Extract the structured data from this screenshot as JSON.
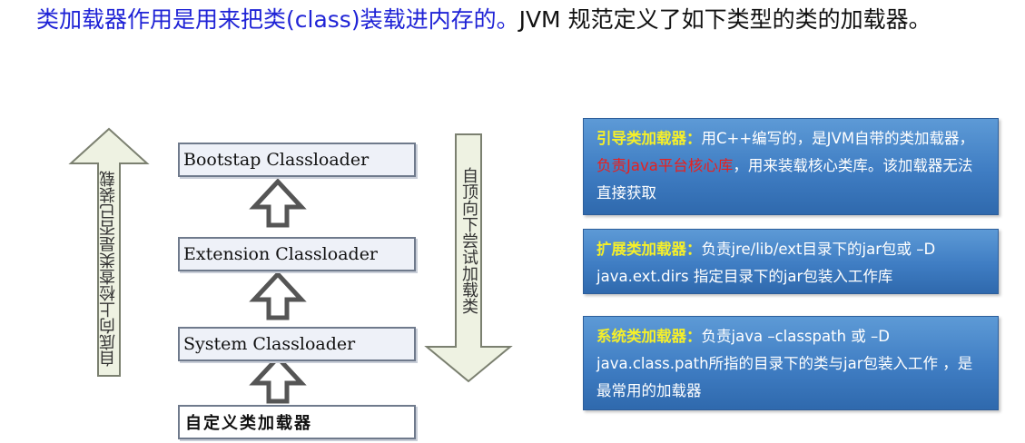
{
  "heading": {
    "highlight": "类加载器作用是用来把类(class)装载进内存的。",
    "rest": "JVM 规范定义了如下类型的类的加载器。"
  },
  "diagram": {
    "loaders": [
      "Bootstap Classloader",
      "Extension Classloader",
      "System Classloader",
      "自定义类加载器"
    ],
    "left_arrow_label": "自底向上检查类是否已装载",
    "right_arrow_label": "自顶向下尝试加载类"
  },
  "info": [
    {
      "title": "引导类加载器",
      "sep": "：",
      "text_a": "用C++编写的，是JVM自带的类加载器，",
      "text_red": "负责Java平台核心库",
      "text_b": "，用来装载核心类库。该加载器无法直接获取"
    },
    {
      "title": "扩展类加载器",
      "sep": "：",
      "text_a": "负责jre/lib/ext目录下的jar包或 –D java.ext.dirs 指定目录下的jar包装入工作库"
    },
    {
      "title": "系统类加载器",
      "sep": "：",
      "text_a": "负责java –classpath 或 –D java.class.path所指的目录下的类与jar包装入工作 ，是最常用的加载器"
    }
  ],
  "colors": {
    "heading_highlight": "#1f23d6",
    "info_title": "#f5ef2a",
    "info_red": "#e8201e",
    "info_box": "#4a86c8",
    "arrow_fill": "#eef2e2",
    "arrow_stroke": "#7b8070"
  }
}
